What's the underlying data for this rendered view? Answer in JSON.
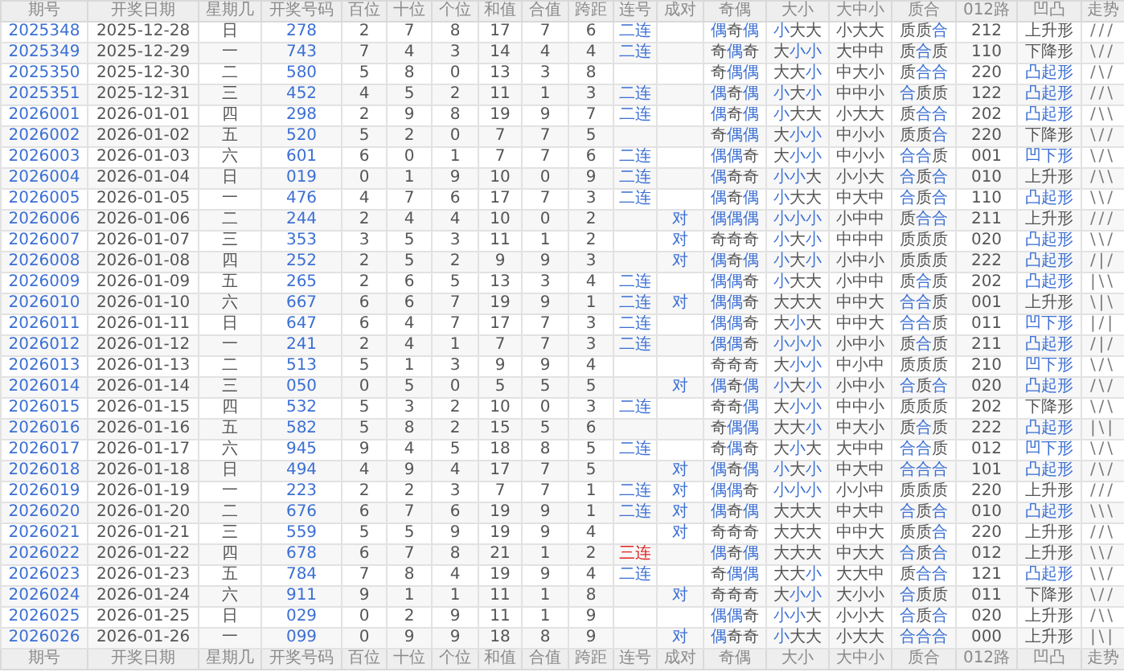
{
  "header": [
    "期号",
    "开奖日期",
    "星期几",
    "开奖号码",
    "百位",
    "十位",
    "个位",
    "和值",
    "合值",
    "跨距",
    "连号",
    "成对",
    "奇偶",
    "大小",
    "大中小",
    "质合",
    "012路",
    "凹凸",
    "走势"
  ],
  "rows": [
    {
      "issue": "2025348",
      "date": "2025-12-28",
      "weekday": "日",
      "number": "278",
      "hundreds": "2",
      "tens": "7",
      "units": "8",
      "sum": "17",
      "sum_mod": "7",
      "span": "6",
      "consecutive": {
        "text": "二连",
        "alert": false
      },
      "parity": {
        "text": "偶奇偶",
        "marks": [
          true,
          false,
          true
        ]
      },
      "size": {
        "text": "小大大",
        "marks": [
          true,
          false,
          false
        ]
      },
      "range": "小大大",
      "prime": {
        "text": "质质合",
        "marks": [
          false,
          false,
          true
        ]
      },
      "route": "212",
      "shape": {
        "text": "上升形",
        "highlight": false
      },
      "trend": "///"
    },
    {
      "issue": "2025349",
      "date": "2025-12-29",
      "weekday": "一",
      "number": "743",
      "hundreds": "7",
      "tens": "4",
      "units": "3",
      "sum": "14",
      "sum_mod": "4",
      "span": "4",
      "consecutive": {
        "text": "二连",
        "alert": false
      },
      "parity": {
        "text": "奇偶奇",
        "marks": [
          false,
          true,
          false
        ]
      },
      "size": {
        "text": "大小小",
        "marks": [
          false,
          true,
          true
        ]
      },
      "range": "大中中",
      "prime": {
        "text": "质合质",
        "marks": [
          false,
          true,
          false
        ]
      },
      "route": "110",
      "shape": {
        "text": "下降形",
        "highlight": false
      },
      "trend": "\\//"
    },
    {
      "issue": "2025350",
      "date": "2025-12-30",
      "weekday": "二",
      "number": "580",
      "hundreds": "5",
      "tens": "8",
      "units": "0",
      "sum": "13",
      "sum_mod": "3",
      "span": "8",
      "parity": {
        "text": "奇偶偶",
        "marks": [
          false,
          true,
          true
        ]
      },
      "size": {
        "text": "大大小",
        "marks": [
          false,
          false,
          true
        ]
      },
      "range": "中大小",
      "prime": {
        "text": "质合合",
        "marks": [
          false,
          true,
          true
        ]
      },
      "route": "220",
      "shape": {
        "text": "凸起形",
        "highlight": true
      },
      "trend": "/\\/"
    },
    {
      "issue": "2025351",
      "date": "2025-12-31",
      "weekday": "三",
      "number": "452",
      "hundreds": "4",
      "tens": "5",
      "units": "2",
      "sum": "11",
      "sum_mod": "1",
      "span": "3",
      "consecutive": {
        "text": "二连",
        "alert": false
      },
      "parity": {
        "text": "偶奇偶",
        "marks": [
          true,
          false,
          true
        ]
      },
      "size": {
        "text": "小大小",
        "marks": [
          true,
          false,
          true
        ]
      },
      "range": "中中小",
      "prime": {
        "text": "合质质",
        "marks": [
          true,
          false,
          false
        ]
      },
      "route": "122",
      "shape": {
        "text": "凸起形",
        "highlight": true
      },
      "trend": "//\\"
    },
    {
      "issue": "2026001",
      "date": "2026-01-01",
      "weekday": "四",
      "number": "298",
      "hundreds": "2",
      "tens": "9",
      "units": "8",
      "sum": "19",
      "sum_mod": "9",
      "span": "7",
      "consecutive": {
        "text": "二连",
        "alert": false
      },
      "parity": {
        "text": "偶奇偶",
        "marks": [
          true,
          false,
          true
        ]
      },
      "size": {
        "text": "小大大",
        "marks": [
          true,
          false,
          false
        ]
      },
      "range": "小大大",
      "prime": {
        "text": "质合合",
        "marks": [
          false,
          true,
          true
        ]
      },
      "route": "202",
      "shape": {
        "text": "凸起形",
        "highlight": true
      },
      "trend": "/\\\\"
    },
    {
      "issue": "2026002",
      "date": "2026-01-02",
      "weekday": "五",
      "number": "520",
      "hundreds": "5",
      "tens": "2",
      "units": "0",
      "sum": "7",
      "sum_mod": "7",
      "span": "5",
      "parity": {
        "text": "奇偶偶",
        "marks": [
          false,
          true,
          true
        ]
      },
      "size": {
        "text": "大小小",
        "marks": [
          false,
          true,
          true
        ]
      },
      "range": "中小小",
      "prime": {
        "text": "质质合",
        "marks": [
          false,
          false,
          true
        ]
      },
      "route": "220",
      "shape": {
        "text": "下降形",
        "highlight": false
      },
      "trend": "\\//"
    },
    {
      "issue": "2026003",
      "date": "2026-01-03",
      "weekday": "六",
      "number": "601",
      "hundreds": "6",
      "tens": "0",
      "units": "1",
      "sum": "7",
      "sum_mod": "7",
      "span": "6",
      "consecutive": {
        "text": "二连",
        "alert": false
      },
      "parity": {
        "text": "偶偶奇",
        "marks": [
          true,
          true,
          false
        ]
      },
      "size": {
        "text": "大小小",
        "marks": [
          false,
          true,
          true
        ]
      },
      "range": "中小小",
      "prime": {
        "text": "合合质",
        "marks": [
          true,
          true,
          false
        ]
      },
      "route": "001",
      "shape": {
        "text": "凹下形",
        "highlight": true
      },
      "trend": "\\/\\"
    },
    {
      "issue": "2026004",
      "date": "2026-01-04",
      "weekday": "日",
      "number": "019",
      "hundreds": "0",
      "tens": "1",
      "units": "9",
      "sum": "10",
      "sum_mod": "0",
      "span": "9",
      "consecutive": {
        "text": "二连",
        "alert": false
      },
      "parity": {
        "text": "偶奇奇",
        "marks": [
          true,
          false,
          false
        ]
      },
      "size": {
        "text": "小小大",
        "marks": [
          true,
          true,
          false
        ]
      },
      "range": "小小大",
      "prime": {
        "text": "合质合",
        "marks": [
          true,
          false,
          true
        ]
      },
      "route": "010",
      "shape": {
        "text": "上升形",
        "highlight": false
      },
      "trend": "/\\\\"
    },
    {
      "issue": "2026005",
      "date": "2026-01-05",
      "weekday": "一",
      "number": "476",
      "hundreds": "4",
      "tens": "7",
      "units": "6",
      "sum": "17",
      "sum_mod": "7",
      "span": "3",
      "consecutive": {
        "text": "二连",
        "alert": false
      },
      "parity": {
        "text": "偶奇偶",
        "marks": [
          true,
          false,
          true
        ]
      },
      "size": {
        "text": "小大大",
        "marks": [
          true,
          false,
          false
        ]
      },
      "range": "中大中",
      "prime": {
        "text": "合质合",
        "marks": [
          true,
          false,
          true
        ]
      },
      "route": "110",
      "shape": {
        "text": "凸起形",
        "highlight": true
      },
      "trend": "\\\\/"
    },
    {
      "issue": "2026006",
      "date": "2026-01-06",
      "weekday": "二",
      "number": "244",
      "hundreds": "2",
      "tens": "4",
      "units": "4",
      "sum": "10",
      "sum_mod": "0",
      "span": "2",
      "pair": "对",
      "parity": {
        "text": "偶偶偶",
        "marks": [
          true,
          true,
          true
        ]
      },
      "size": {
        "text": "小小小",
        "marks": [
          true,
          true,
          true
        ]
      },
      "range": "小中中",
      "prime": {
        "text": "质合合",
        "marks": [
          false,
          true,
          true
        ]
      },
      "route": "211",
      "shape": {
        "text": "上升形",
        "highlight": false
      },
      "trend": "///"
    },
    {
      "issue": "2026007",
      "date": "2026-01-07",
      "weekday": "三",
      "number": "353",
      "hundreds": "3",
      "tens": "5",
      "units": "3",
      "sum": "11",
      "sum_mod": "1",
      "span": "2",
      "pair": "对",
      "parity": {
        "text": "奇奇奇",
        "marks": [
          false,
          false,
          false
        ]
      },
      "size": {
        "text": "小大小",
        "marks": [
          true,
          false,
          true
        ]
      },
      "range": "中中中",
      "prime": {
        "text": "质质质",
        "marks": [
          false,
          false,
          false
        ]
      },
      "route": "020",
      "shape": {
        "text": "凸起形",
        "highlight": true
      },
      "trend": "\\\\/"
    },
    {
      "issue": "2026008",
      "date": "2026-01-08",
      "weekday": "四",
      "number": "252",
      "hundreds": "2",
      "tens": "5",
      "units": "2",
      "sum": "9",
      "sum_mod": "9",
      "span": "3",
      "pair": "对",
      "parity": {
        "text": "偶奇偶",
        "marks": [
          true,
          false,
          true
        ]
      },
      "size": {
        "text": "小大小",
        "marks": [
          true,
          false,
          true
        ]
      },
      "range": "小中小",
      "prime": {
        "text": "质质质",
        "marks": [
          false,
          false,
          false
        ]
      },
      "route": "222",
      "shape": {
        "text": "凸起形",
        "highlight": true
      },
      "trend": "/|/"
    },
    {
      "issue": "2026009",
      "date": "2026-01-09",
      "weekday": "五",
      "number": "265",
      "hundreds": "2",
      "tens": "6",
      "units": "5",
      "sum": "13",
      "sum_mod": "3",
      "span": "4",
      "consecutive": {
        "text": "二连",
        "alert": false
      },
      "parity": {
        "text": "偶偶奇",
        "marks": [
          true,
          true,
          false
        ]
      },
      "size": {
        "text": "小大大",
        "marks": [
          true,
          false,
          false
        ]
      },
      "range": "小中中",
      "prime": {
        "text": "质合质",
        "marks": [
          false,
          true,
          false
        ]
      },
      "route": "202",
      "shape": {
        "text": "凸起形",
        "highlight": true
      },
      "trend": "|\\\\"
    },
    {
      "issue": "2026010",
      "date": "2026-01-10",
      "weekday": "六",
      "number": "667",
      "hundreds": "6",
      "tens": "6",
      "units": "7",
      "sum": "19",
      "sum_mod": "9",
      "span": "1",
      "consecutive": {
        "text": "二连",
        "alert": false
      },
      "pair": "对",
      "parity": {
        "text": "偶偶奇",
        "marks": [
          true,
          true,
          false
        ]
      },
      "size": {
        "text": "大大大",
        "marks": [
          false,
          false,
          false
        ]
      },
      "range": "中中大",
      "prime": {
        "text": "合合质",
        "marks": [
          true,
          true,
          false
        ]
      },
      "route": "001",
      "shape": {
        "text": "上升形",
        "highlight": false
      },
      "trend": "\\|\\"
    },
    {
      "issue": "2026011",
      "date": "2026-01-11",
      "weekday": "日",
      "number": "647",
      "hundreds": "6",
      "tens": "4",
      "units": "7",
      "sum": "17",
      "sum_mod": "7",
      "span": "3",
      "consecutive": {
        "text": "二连",
        "alert": false
      },
      "parity": {
        "text": "偶偶奇",
        "marks": [
          true,
          true,
          false
        ]
      },
      "size": {
        "text": "大小大",
        "marks": [
          false,
          true,
          false
        ]
      },
      "range": "中中大",
      "prime": {
        "text": "合合质",
        "marks": [
          true,
          true,
          false
        ]
      },
      "route": "011",
      "shape": {
        "text": "凹下形",
        "highlight": true
      },
      "trend": "|/|"
    },
    {
      "issue": "2026012",
      "date": "2026-01-12",
      "weekday": "一",
      "number": "241",
      "hundreds": "2",
      "tens": "4",
      "units": "1",
      "sum": "7",
      "sum_mod": "7",
      "span": "3",
      "consecutive": {
        "text": "二连",
        "alert": false
      },
      "parity": {
        "text": "偶偶奇",
        "marks": [
          true,
          true,
          false
        ]
      },
      "size": {
        "text": "小小小",
        "marks": [
          true,
          true,
          true
        ]
      },
      "range": "小中小",
      "prime": {
        "text": "质合质",
        "marks": [
          false,
          true,
          false
        ]
      },
      "route": "211",
      "shape": {
        "text": "凸起形",
        "highlight": true
      },
      "trend": "/|/"
    },
    {
      "issue": "2026013",
      "date": "2026-01-13",
      "weekday": "二",
      "number": "513",
      "hundreds": "5",
      "tens": "1",
      "units": "3",
      "sum": "9",
      "sum_mod": "9",
      "span": "4",
      "parity": {
        "text": "奇奇奇",
        "marks": [
          false,
          false,
          false
        ]
      },
      "size": {
        "text": "大小小",
        "marks": [
          false,
          true,
          true
        ]
      },
      "range": "中小中",
      "prime": {
        "text": "质质质",
        "marks": [
          false,
          false,
          false
        ]
      },
      "route": "210",
      "shape": {
        "text": "凹下形",
        "highlight": true
      },
      "trend": "\\/\\"
    },
    {
      "issue": "2026014",
      "date": "2026-01-14",
      "weekday": "三",
      "number": "050",
      "hundreds": "0",
      "tens": "5",
      "units": "0",
      "sum": "5",
      "sum_mod": "5",
      "span": "5",
      "pair": "对",
      "parity": {
        "text": "偶奇偶",
        "marks": [
          true,
          false,
          true
        ]
      },
      "size": {
        "text": "小大小",
        "marks": [
          true,
          false,
          true
        ]
      },
      "range": "小中小",
      "prime": {
        "text": "合质合",
        "marks": [
          true,
          false,
          true
        ]
      },
      "route": "020",
      "shape": {
        "text": "凸起形",
        "highlight": true
      },
      "trend": "/\\/"
    },
    {
      "issue": "2026015",
      "date": "2026-01-15",
      "weekday": "四",
      "number": "532",
      "hundreds": "5",
      "tens": "3",
      "units": "2",
      "sum": "10",
      "sum_mod": "0",
      "span": "3",
      "consecutive": {
        "text": "二连",
        "alert": false
      },
      "parity": {
        "text": "奇奇偶",
        "marks": [
          false,
          false,
          true
        ]
      },
      "size": {
        "text": "大小小",
        "marks": [
          false,
          true,
          true
        ]
      },
      "range": "中中小",
      "prime": {
        "text": "质质质",
        "marks": [
          false,
          false,
          false
        ]
      },
      "route": "202",
      "shape": {
        "text": "下降形",
        "highlight": false
      },
      "trend": "\\/\\"
    },
    {
      "issue": "2026016",
      "date": "2026-01-16",
      "weekday": "五",
      "number": "582",
      "hundreds": "5",
      "tens": "8",
      "units": "2",
      "sum": "15",
      "sum_mod": "5",
      "span": "6",
      "parity": {
        "text": "奇偶偶",
        "marks": [
          false,
          true,
          true
        ]
      },
      "size": {
        "text": "大大小",
        "marks": [
          false,
          false,
          true
        ]
      },
      "range": "中大小",
      "prime": {
        "text": "质合质",
        "marks": [
          false,
          true,
          false
        ]
      },
      "route": "222",
      "shape": {
        "text": "凸起形",
        "highlight": true
      },
      "trend": "|\\|"
    },
    {
      "issue": "2026017",
      "date": "2026-01-17",
      "weekday": "六",
      "number": "945",
      "hundreds": "9",
      "tens": "4",
      "units": "5",
      "sum": "18",
      "sum_mod": "8",
      "span": "5",
      "consecutive": {
        "text": "二连",
        "alert": false
      },
      "parity": {
        "text": "奇偶奇",
        "marks": [
          false,
          true,
          false
        ]
      },
      "size": {
        "text": "大小大",
        "marks": [
          false,
          true,
          false
        ]
      },
      "range": "大中中",
      "prime": {
        "text": "合合质",
        "marks": [
          true,
          true,
          false
        ]
      },
      "route": "012",
      "shape": {
        "text": "凹下形",
        "highlight": true
      },
      "trend": "\\/\\"
    },
    {
      "issue": "2026018",
      "date": "2026-01-18",
      "weekday": "日",
      "number": "494",
      "hundreds": "4",
      "tens": "9",
      "units": "4",
      "sum": "17",
      "sum_mod": "7",
      "span": "5",
      "pair": "对",
      "parity": {
        "text": "偶奇偶",
        "marks": [
          true,
          false,
          true
        ]
      },
      "size": {
        "text": "小大小",
        "marks": [
          true,
          false,
          true
        ]
      },
      "range": "中大中",
      "prime": {
        "text": "合合合",
        "marks": [
          true,
          true,
          true
        ]
      },
      "route": "101",
      "shape": {
        "text": "凸起形",
        "highlight": true
      },
      "trend": "/\\/"
    },
    {
      "issue": "2026019",
      "date": "2026-01-19",
      "weekday": "一",
      "number": "223",
      "hundreds": "2",
      "tens": "2",
      "units": "3",
      "sum": "7",
      "sum_mod": "7",
      "span": "1",
      "consecutive": {
        "text": "二连",
        "alert": false
      },
      "pair": "对",
      "parity": {
        "text": "偶偶奇",
        "marks": [
          true,
          true,
          false
        ]
      },
      "size": {
        "text": "小小小",
        "marks": [
          true,
          true,
          true
        ]
      },
      "range": "小小中",
      "prime": {
        "text": "质质质",
        "marks": [
          false,
          false,
          false
        ]
      },
      "route": "220",
      "shape": {
        "text": "上升形",
        "highlight": false
      },
      "trend": "///"
    },
    {
      "issue": "2026020",
      "date": "2026-01-20",
      "weekday": "二",
      "number": "676",
      "hundreds": "6",
      "tens": "7",
      "units": "6",
      "sum": "19",
      "sum_mod": "9",
      "span": "1",
      "consecutive": {
        "text": "二连",
        "alert": false
      },
      "pair": "对",
      "parity": {
        "text": "偶奇偶",
        "marks": [
          true,
          false,
          true
        ]
      },
      "size": {
        "text": "大大大",
        "marks": [
          false,
          false,
          false
        ]
      },
      "range": "中大中",
      "prime": {
        "text": "合质合",
        "marks": [
          true,
          false,
          true
        ]
      },
      "route": "010",
      "shape": {
        "text": "凸起形",
        "highlight": true
      },
      "trend": "\\\\\\"
    },
    {
      "issue": "2026021",
      "date": "2026-01-21",
      "weekday": "三",
      "number": "559",
      "hundreds": "5",
      "tens": "5",
      "units": "9",
      "sum": "19",
      "sum_mod": "9",
      "span": "4",
      "pair": "对",
      "parity": {
        "text": "奇奇奇",
        "marks": [
          false,
          false,
          false
        ]
      },
      "size": {
        "text": "大大大",
        "marks": [
          false,
          false,
          false
        ]
      },
      "range": "中中大",
      "prime": {
        "text": "质质合",
        "marks": [
          false,
          false,
          true
        ]
      },
      "route": "220",
      "shape": {
        "text": "上升形",
        "highlight": false
      },
      "trend": "//\\"
    },
    {
      "issue": "2026022",
      "date": "2026-01-22",
      "weekday": "四",
      "number": "678",
      "hundreds": "6",
      "tens": "7",
      "units": "8",
      "sum": "21",
      "sum_mod": "1",
      "span": "2",
      "consecutive": {
        "text": "三连",
        "alert": true
      },
      "parity": {
        "text": "偶奇偶",
        "marks": [
          true,
          false,
          true
        ]
      },
      "size": {
        "text": "大大大",
        "marks": [
          false,
          false,
          false
        ]
      },
      "range": "中大大",
      "prime": {
        "text": "合质合",
        "marks": [
          true,
          false,
          true
        ]
      },
      "route": "012",
      "shape": {
        "text": "上升形",
        "highlight": false
      },
      "trend": "\\\\/"
    },
    {
      "issue": "2026023",
      "date": "2026-01-23",
      "weekday": "五",
      "number": "784",
      "hundreds": "7",
      "tens": "8",
      "units": "4",
      "sum": "19",
      "sum_mod": "9",
      "span": "4",
      "consecutive": {
        "text": "二连",
        "alert": false
      },
      "parity": {
        "text": "奇偶偶",
        "marks": [
          false,
          true,
          true
        ]
      },
      "size": {
        "text": "大大小",
        "marks": [
          false,
          false,
          true
        ]
      },
      "range": "大大中",
      "prime": {
        "text": "质合合",
        "marks": [
          false,
          true,
          true
        ]
      },
      "route": "121",
      "shape": {
        "text": "凸起形",
        "highlight": true
      },
      "trend": "\\\\/"
    },
    {
      "issue": "2026024",
      "date": "2026-01-24",
      "weekday": "六",
      "number": "911",
      "hundreds": "9",
      "tens": "1",
      "units": "1",
      "sum": "11",
      "sum_mod": "1",
      "span": "8",
      "pair": "对",
      "parity": {
        "text": "奇奇奇",
        "marks": [
          false,
          false,
          false
        ]
      },
      "size": {
        "text": "大小小",
        "marks": [
          false,
          true,
          true
        ]
      },
      "range": "大小小",
      "prime": {
        "text": "合质质",
        "marks": [
          true,
          false,
          false
        ]
      },
      "route": "011",
      "shape": {
        "text": "下降形",
        "highlight": false
      },
      "trend": "\\//"
    },
    {
      "issue": "2026025",
      "date": "2026-01-25",
      "weekday": "日",
      "number": "029",
      "hundreds": "0",
      "tens": "2",
      "units": "9",
      "sum": "11",
      "sum_mod": "1",
      "span": "9",
      "parity": {
        "text": "偶偶奇",
        "marks": [
          true,
          true,
          false
        ]
      },
      "size": {
        "text": "小小大",
        "marks": [
          true,
          true,
          false
        ]
      },
      "range": "小小大",
      "prime": {
        "text": "合质合",
        "marks": [
          true,
          false,
          true
        ]
      },
      "route": "020",
      "shape": {
        "text": "上升形",
        "highlight": false
      },
      "trend": "/\\\\"
    },
    {
      "issue": "2026026",
      "date": "2026-01-26",
      "weekday": "一",
      "number": "099",
      "hundreds": "0",
      "tens": "9",
      "units": "9",
      "sum": "18",
      "sum_mod": "8",
      "span": "9",
      "pair": "对",
      "parity": {
        "text": "偶奇奇",
        "marks": [
          true,
          false,
          false
        ]
      },
      "size": {
        "text": "小大大",
        "marks": [
          true,
          false,
          false
        ]
      },
      "range": "小大大",
      "prime": {
        "text": "合合合",
        "marks": [
          true,
          true,
          true
        ]
      },
      "route": "000",
      "shape": {
        "text": "上升形",
        "highlight": false
      },
      "trend": "|\\|"
    }
  ],
  "footer": [
    "期号",
    "开奖日期",
    "星期几",
    "开奖号码",
    "百位",
    "十位",
    "个位",
    "和值",
    "合值",
    "跨距",
    "连号",
    "成对",
    "奇偶",
    "大小",
    "大中小",
    "质合",
    "012路",
    "凹凸",
    "走势"
  ]
}
